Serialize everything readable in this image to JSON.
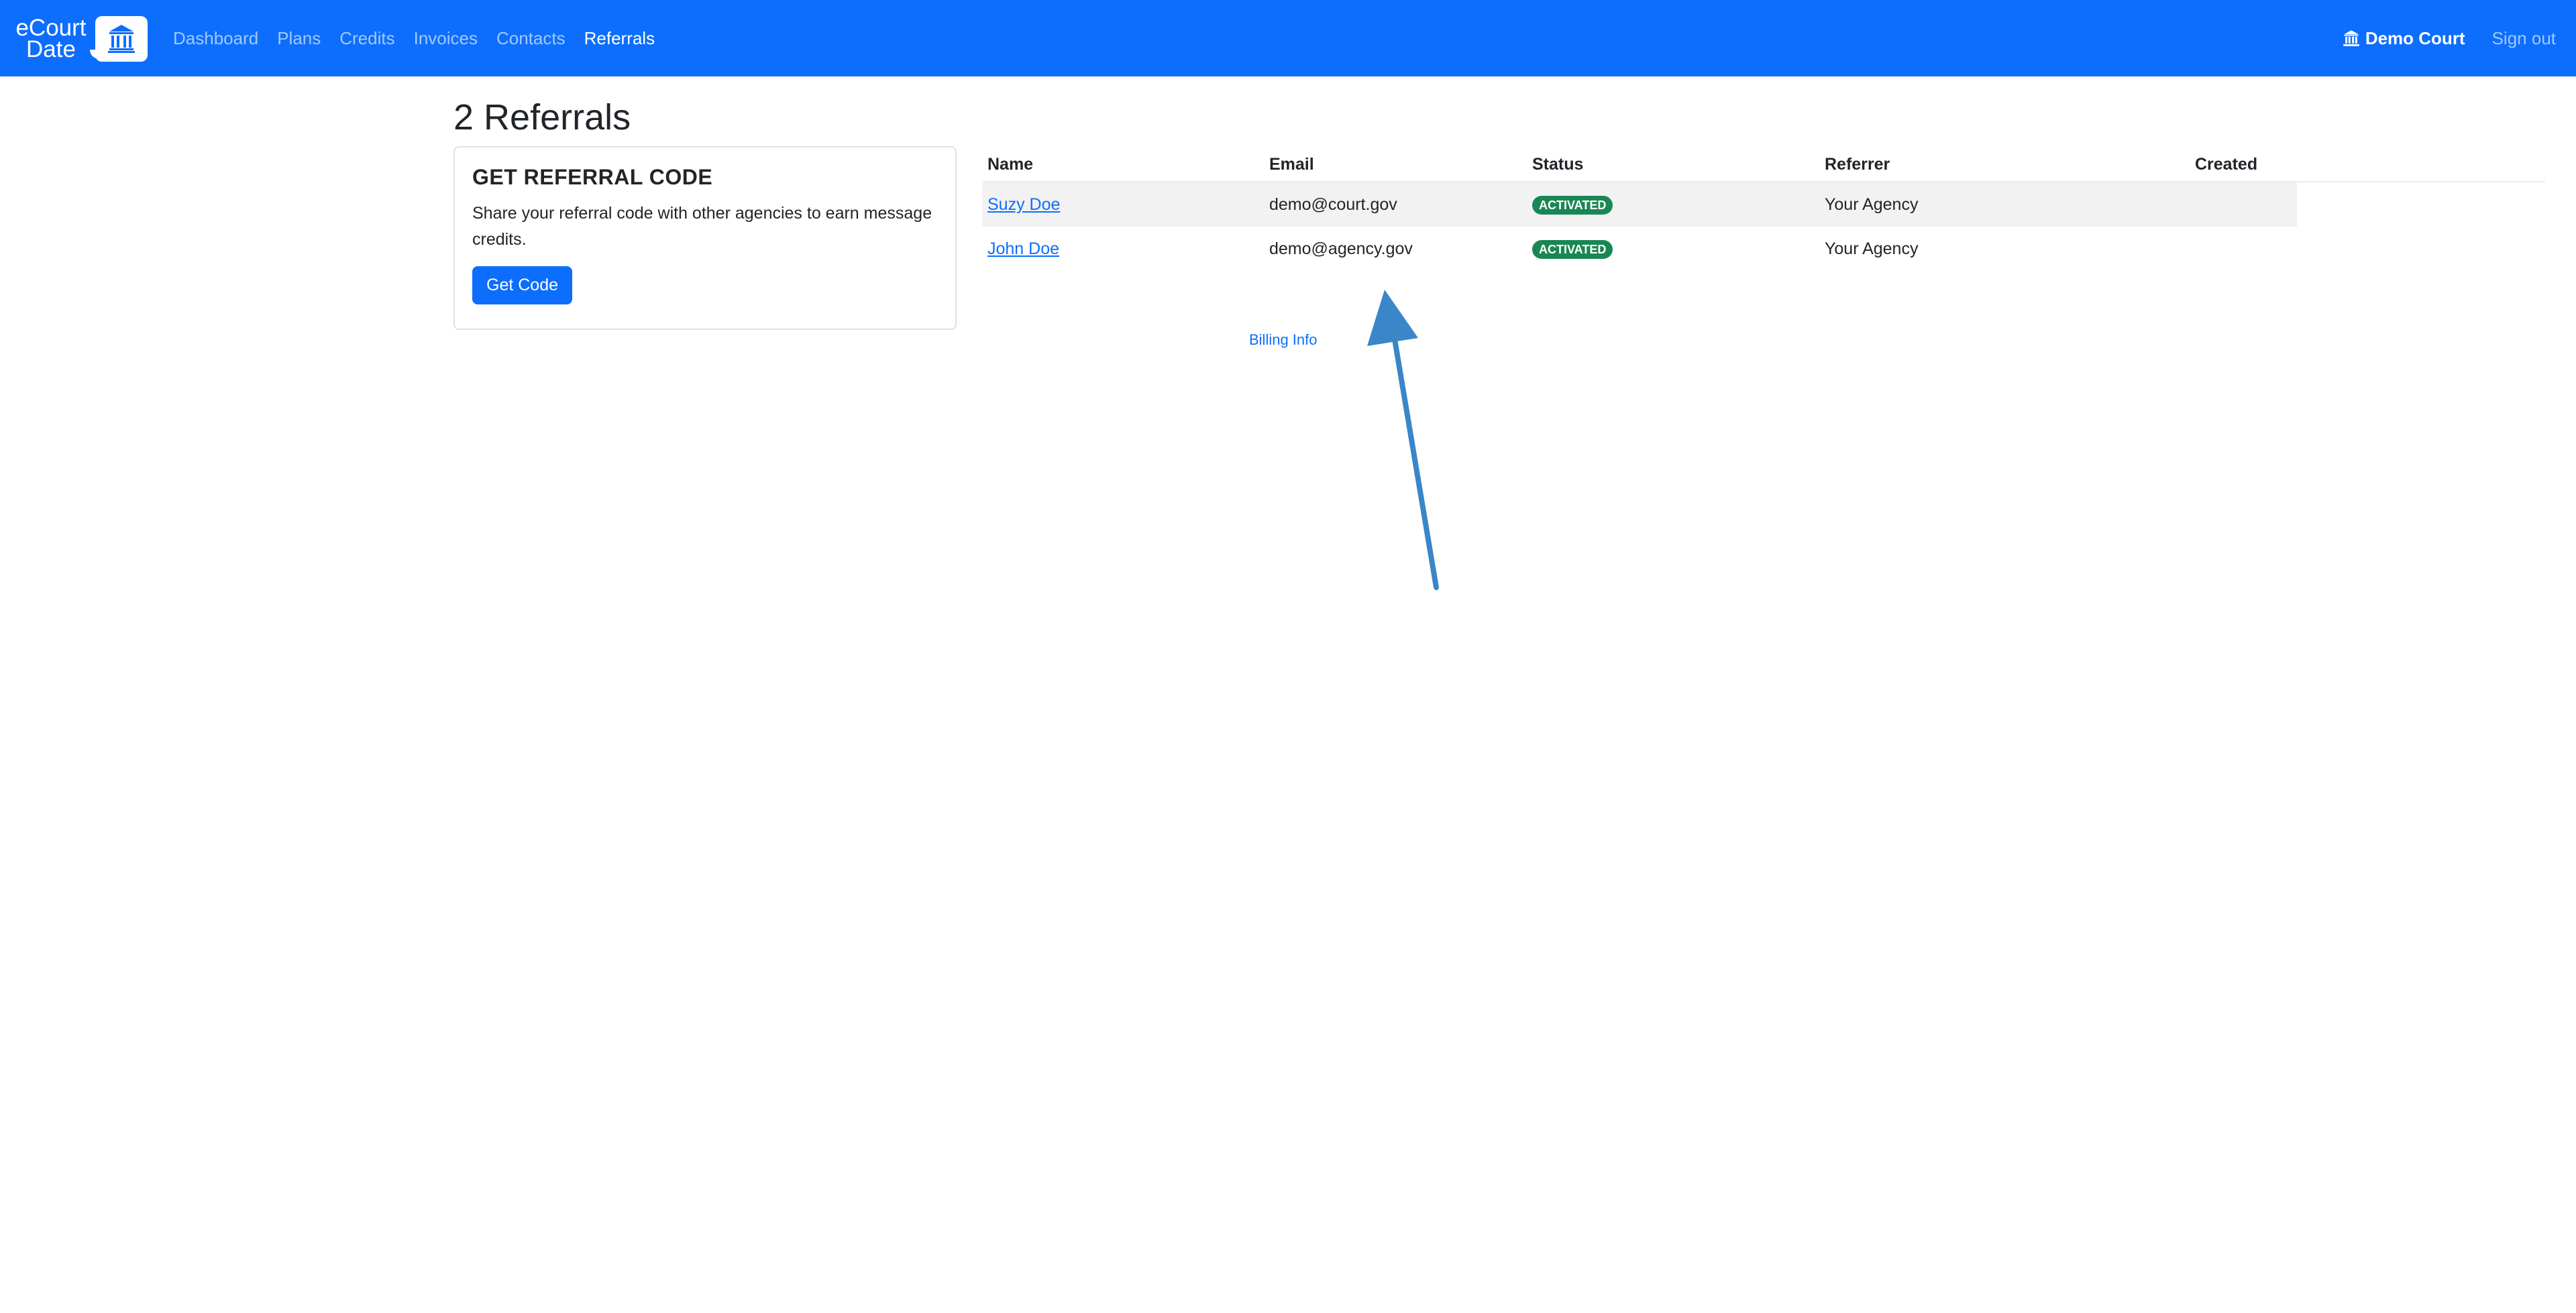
{
  "brand": {
    "line1": "eCourt",
    "line2": "Date",
    "logo_icon": "courthouse-icon"
  },
  "nav": {
    "links": [
      {
        "label": "Dashboard"
      },
      {
        "label": "Plans"
      },
      {
        "label": "Credits"
      },
      {
        "label": "Invoices"
      },
      {
        "label": "Contacts"
      },
      {
        "label": "Referrals",
        "active": true
      }
    ],
    "court_name": "Demo Court",
    "court_icon": "courthouse-icon",
    "signout_label": "Sign out"
  },
  "page": {
    "title": "2 Referrals"
  },
  "referral_card": {
    "title": "GET REFERRAL CODE",
    "text": "Share your referral code with other agencies to earn message credits.",
    "button_label": "Get Code"
  },
  "table": {
    "headers": {
      "name": "Name",
      "email": "Email",
      "status": "Status",
      "referrer": "Referrer",
      "created": "Created"
    },
    "rows": [
      {
        "name": "Suzy Doe",
        "email": "demo@court.gov",
        "status": "ACTIVATED",
        "referrer": "Your Agency",
        "created": ""
      },
      {
        "name": "John Doe",
        "email": "demo@agency.gov",
        "status": "ACTIVATED",
        "referrer": "Your Agency",
        "created": ""
      }
    ]
  },
  "footer": {
    "billing_link": "Billing Info"
  },
  "colors": {
    "primary": "#0d6efd",
    "success": "#198754",
    "annotation_arrow": "#3a86c8"
  }
}
